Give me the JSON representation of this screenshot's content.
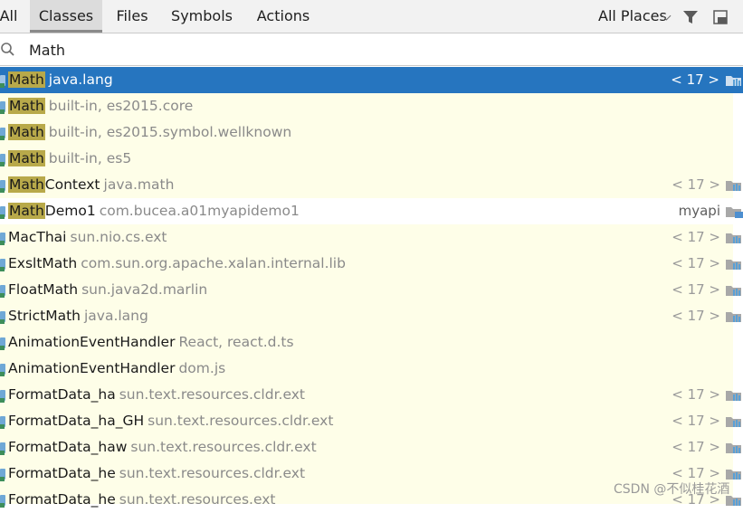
{
  "tabs": [
    {
      "label": "All",
      "selected": false
    },
    {
      "label": "Classes",
      "selected": true
    },
    {
      "label": "Files",
      "selected": false
    },
    {
      "label": "Symbols",
      "selected": false
    },
    {
      "label": "Actions",
      "selected": false
    }
  ],
  "scope": {
    "label": "All Places"
  },
  "icons": {
    "filter": "filter-icon",
    "pin": "pin-window-icon",
    "search": "search-icon",
    "class": "class-type-icon",
    "library": "library-jar-icon",
    "module": "module-folder-icon"
  },
  "search": {
    "value": "Math"
  },
  "colors": {
    "selection": "#2675bf",
    "highlight": "#b8a94a",
    "nonProjectBg": "#fefee8"
  },
  "results": [
    {
      "match": "Math",
      "rest": "",
      "location": "java.lang",
      "right": "< 17 >",
      "icon": "library",
      "selected": true
    },
    {
      "match": "Math",
      "rest": "",
      "location": "built-in, es2015.core",
      "right": "",
      "icon": "none"
    },
    {
      "match": "Math",
      "rest": "",
      "location": "built-in, es2015.symbol.wellknown",
      "right": "",
      "icon": "none"
    },
    {
      "match": "Math",
      "rest": "",
      "location": "built-in, es5",
      "right": "",
      "icon": "none"
    },
    {
      "match": "Math",
      "rest": "Context",
      "location": "java.math",
      "right": "< 17 >",
      "icon": "library"
    },
    {
      "match": "Math",
      "rest": "Demo1",
      "location": "com.bucea.a01myapidemo1",
      "right": "myapi",
      "icon": "module",
      "project": true
    },
    {
      "match": "",
      "rest": "MacThai",
      "location": "sun.nio.cs.ext",
      "right": "< 17 >",
      "icon": "library"
    },
    {
      "match": "",
      "rest": "ExsltMath",
      "location": "com.sun.org.apache.xalan.internal.lib",
      "right": "< 17 >",
      "icon": "library"
    },
    {
      "match": "",
      "rest": "FloatMath",
      "location": "sun.java2d.marlin",
      "right": "< 17 >",
      "icon": "library"
    },
    {
      "match": "",
      "rest": "StrictMath",
      "location": "java.lang",
      "right": "< 17 >",
      "icon": "library"
    },
    {
      "match": "",
      "rest": "AnimationEventHandler",
      "location": "React, react.d.ts",
      "right": "",
      "icon": "none"
    },
    {
      "match": "",
      "rest": "AnimationEventHandler",
      "location": "dom.js",
      "right": "",
      "icon": "none"
    },
    {
      "match": "",
      "rest": "FormatData_ha",
      "location": "sun.text.resources.cldr.ext",
      "right": "< 17 >",
      "icon": "library"
    },
    {
      "match": "",
      "rest": "FormatData_ha_GH",
      "location": "sun.text.resources.cldr.ext",
      "right": "< 17 >",
      "icon": "library"
    },
    {
      "match": "",
      "rest": "FormatData_haw",
      "location": "sun.text.resources.cldr.ext",
      "right": "< 17 >",
      "icon": "library"
    },
    {
      "match": "",
      "rest": "FormatData_he",
      "location": "sun.text.resources.cldr.ext",
      "right": "< 17 >",
      "icon": "library"
    },
    {
      "match": "",
      "rest": "FormatData_he",
      "location": "sun.text.resources.ext",
      "right": "< 17 >",
      "icon": "library"
    }
  ],
  "watermark": "CSDN @不似桂花酒"
}
